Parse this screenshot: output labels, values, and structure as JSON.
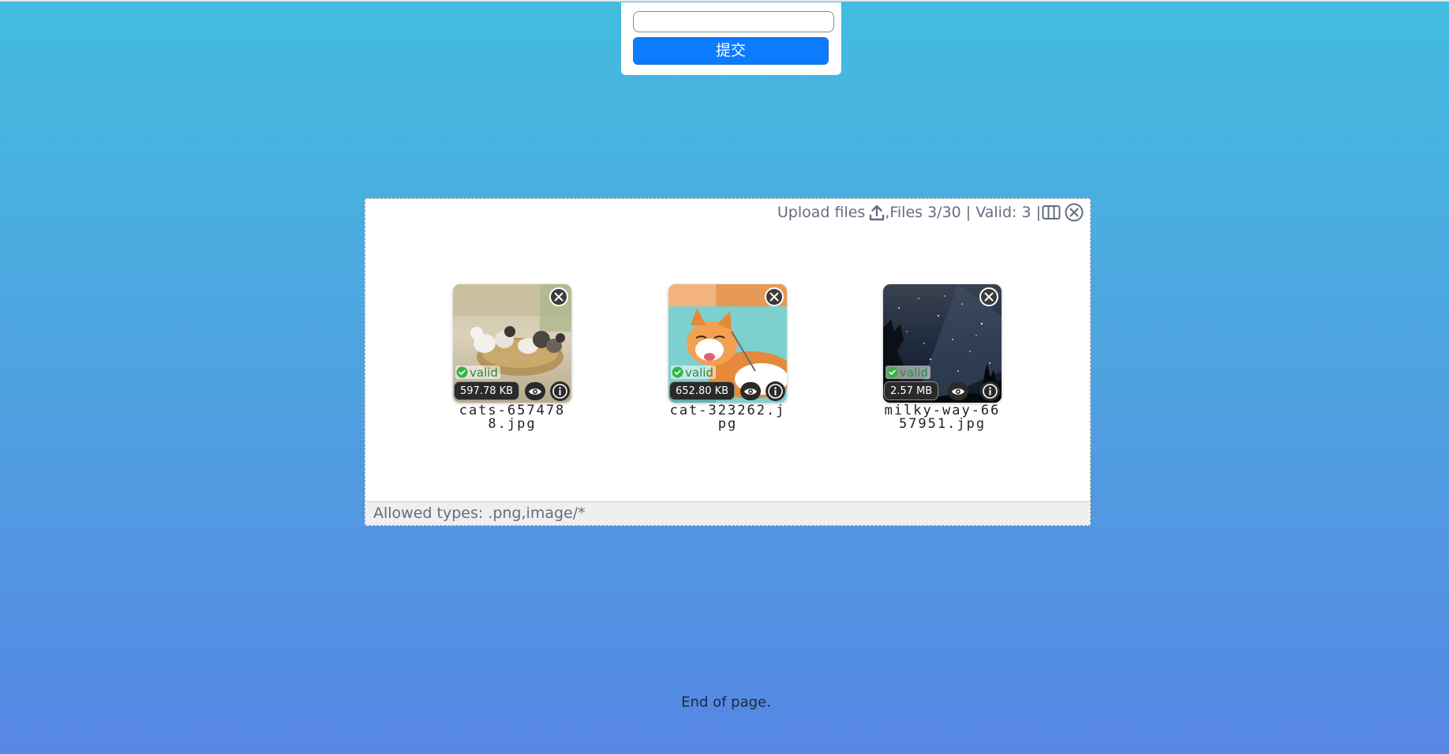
{
  "form": {
    "input_value": "",
    "submit_label": "提交"
  },
  "uploader": {
    "upload_label": "Upload files",
    "status_text": ",Files 3/30 | Valid: 3 |",
    "footer_text": "Allowed types: .png,image/*",
    "files": [
      {
        "name": "cats-6574788.jpg",
        "size": "597.78 KB",
        "status": "valid",
        "image": "kittens-in-basket"
      },
      {
        "name": "cat-323262.jpg",
        "size": "652.80 KB",
        "status": "valid",
        "image": "orange-cat-lying"
      },
      {
        "name": "milky-way-6657951.jpg",
        "size": "2.57 MB",
        "status": "valid",
        "image": "night-sky-milky-way"
      }
    ]
  },
  "footer": {
    "end_text": "End of page."
  },
  "colors": {
    "background_top": "#43bce0",
    "background_bottom": "#5687e4",
    "submit_blue": "#0d7bff",
    "valid_green": "#2e8b3a",
    "header_gray": "#646c7f"
  },
  "icons": [
    "upload-icon",
    "columns-icon",
    "clear-all-icon",
    "remove-file-icon",
    "valid-check-icon",
    "eye-icon",
    "info-icon"
  ]
}
